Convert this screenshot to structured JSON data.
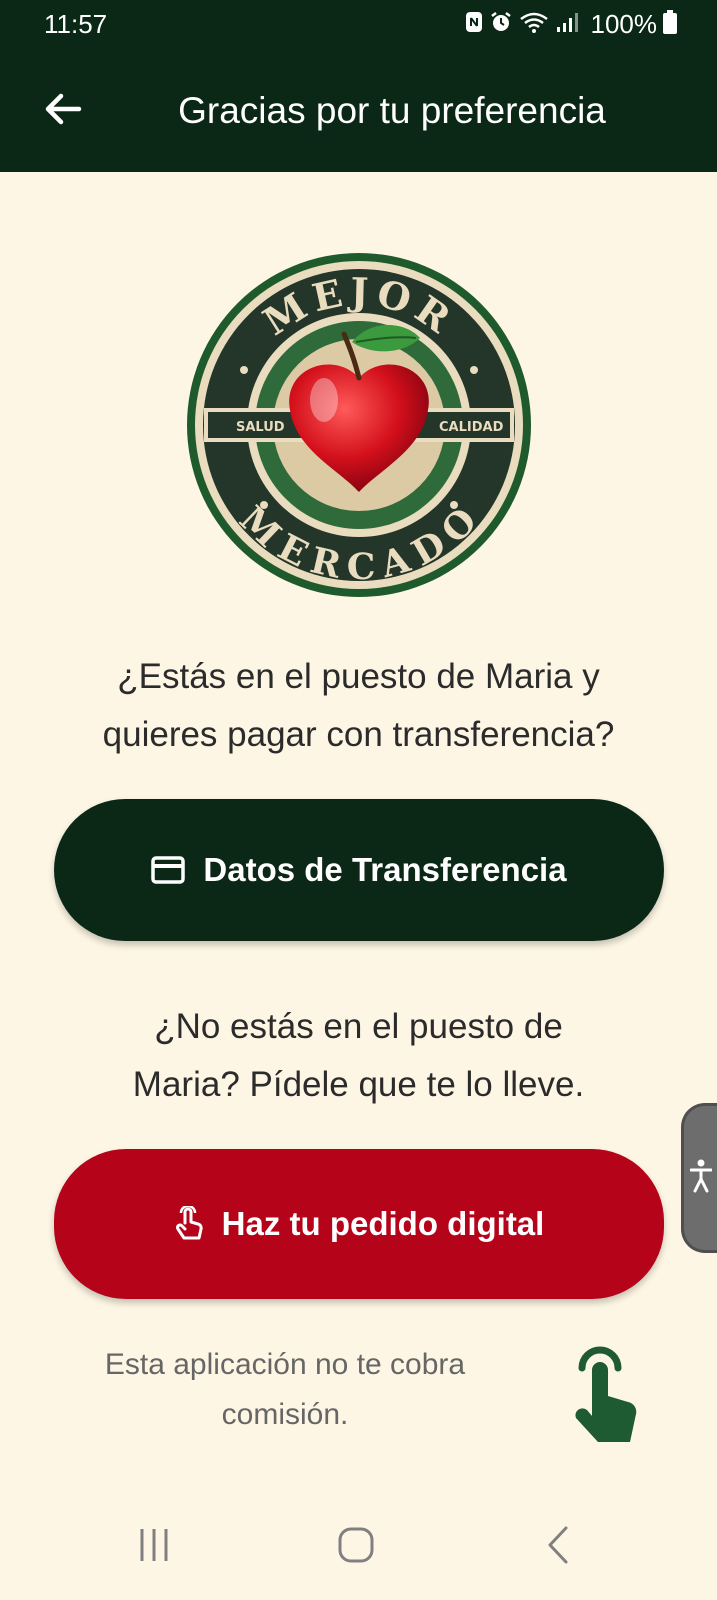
{
  "status_bar": {
    "time": "11:57",
    "battery": "100%",
    "icons": [
      "nfc-icon",
      "alarm-icon",
      "wifi-icon",
      "signal-icon",
      "battery-icon"
    ]
  },
  "app_bar": {
    "back_icon": "arrow-left-icon",
    "title": "Gracias por tu preferencia"
  },
  "logo": {
    "top_text": "MEJOR",
    "bottom_text": "MERCADO",
    "left_banner": "SALUD",
    "right_banner": "CALIDAD"
  },
  "transfer_section": {
    "question_line1": "¿Estás en el puesto de Maria y",
    "question_line2": "quieres pagar con transferencia?",
    "button_label": "Datos de Transferencia",
    "button_icon": "credit-card-icon"
  },
  "order_section": {
    "question_line1": "¿No estás en el puesto de",
    "question_line2": "Maria? Pídele que te lo lleve.",
    "button_label": "Haz tu pedido digital",
    "button_icon": "tap-hand-icon"
  },
  "footer": {
    "line1": "Esta aplicación no te cobra",
    "line2": "comisión."
  },
  "colors": {
    "primary_dark": "#0B2817",
    "accent_red": "#B5041A",
    "background": "#FDF6E4",
    "hand_green": "#1E5A32"
  },
  "nav_bar": {
    "icons": [
      "recent-apps-icon",
      "home-icon",
      "back-chevron-icon"
    ]
  }
}
